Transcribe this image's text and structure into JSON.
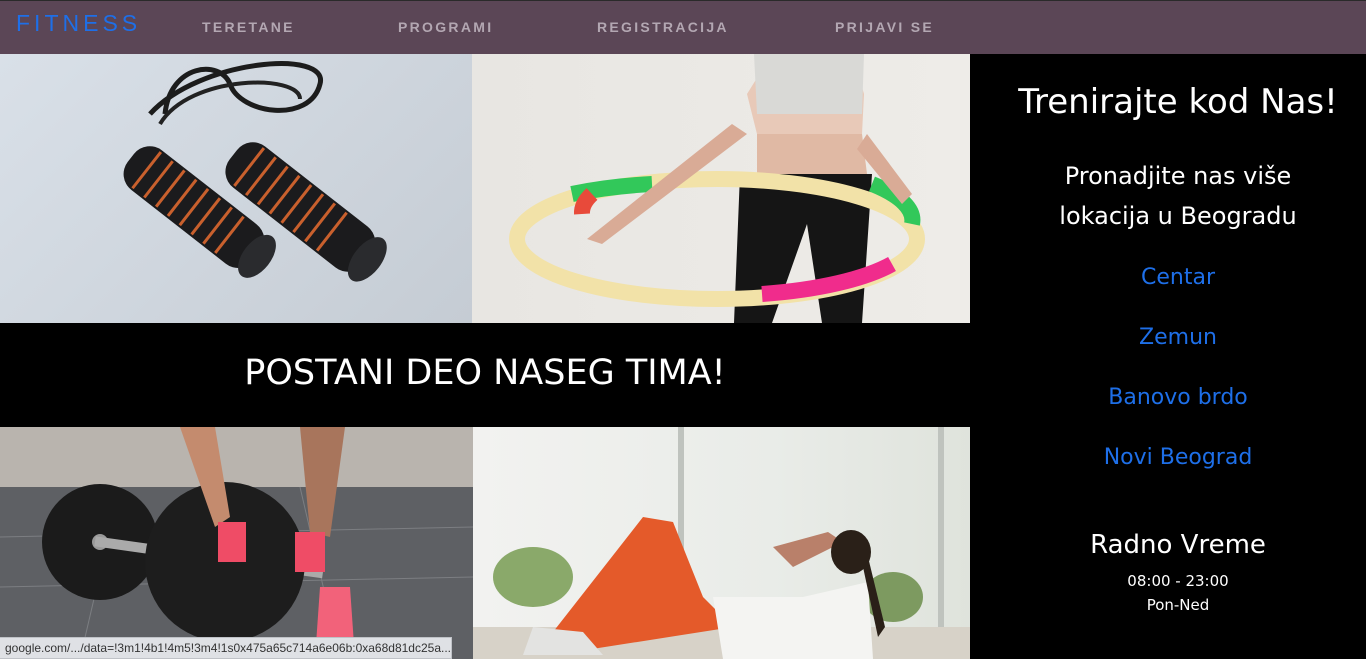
{
  "brand": "FITNESS",
  "nav": [
    "TERETANE",
    "PROGRAMI",
    "REGISTRACIJA",
    "PRIJAVI SE"
  ],
  "banner": "POSTANI DEO NASEG TIMA!",
  "right": {
    "title": "Trenirajte kod Nas!",
    "subtitle_line1": "Pronadjite nas više",
    "subtitle_line2": "lokacija u Beogradu",
    "locations": [
      "Centar",
      "Zemun",
      "Banovo brdo",
      "Novi Beograd"
    ],
    "hours_title": "Radno Vreme",
    "hours_time": "08:00 - 23:00",
    "hours_days": "Pon-Ned"
  },
  "status_url": "google.com/.../data=!3m1!4b1!4m5!3m4!1s0x475a65c714a6e06b:0xa68d81dc25a...",
  "colors": {
    "navbar": "#5b4656",
    "brand": "#1e6fe8",
    "nav_text": "#b3a7b2",
    "link": "#1e6fe8"
  }
}
